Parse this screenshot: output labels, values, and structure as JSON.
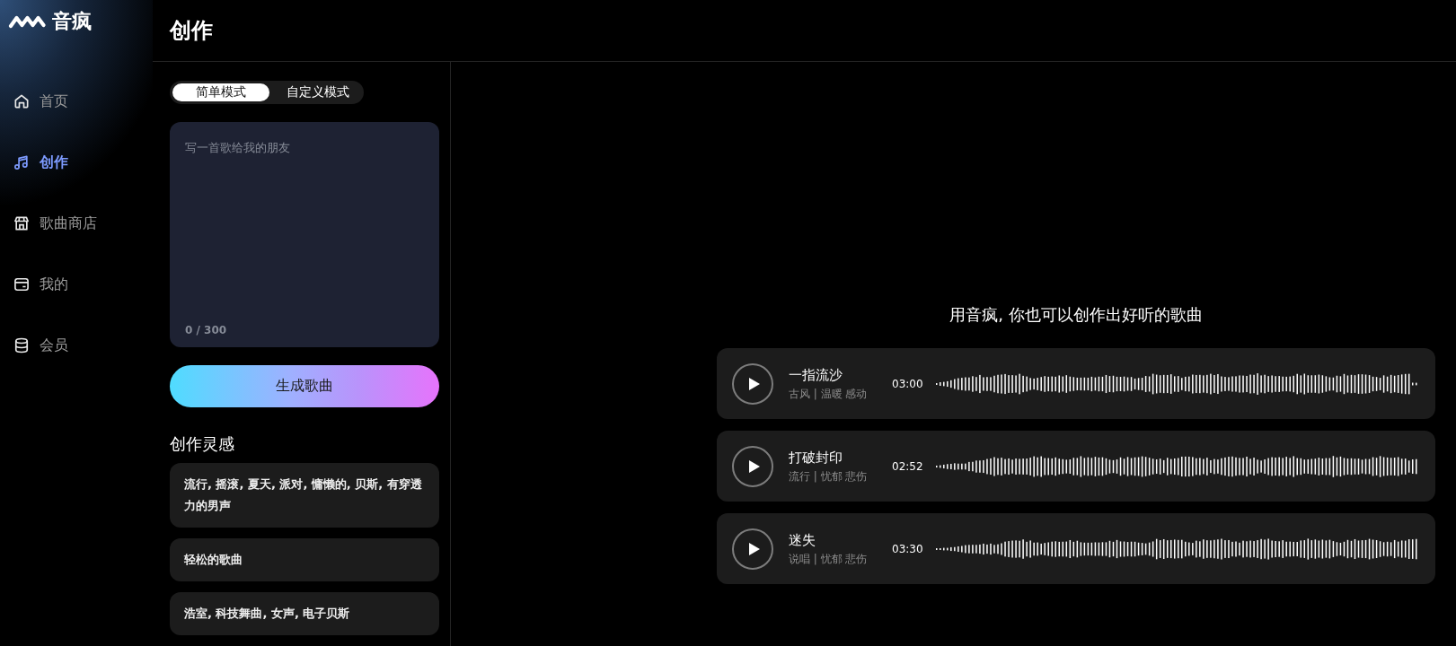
{
  "logo": {
    "name": "音疯"
  },
  "sidebar": {
    "items": [
      {
        "label": "首页",
        "selected": false
      },
      {
        "label": "创作",
        "selected": true
      },
      {
        "label": "歌曲商店",
        "selected": false
      },
      {
        "label": "我的",
        "selected": false
      },
      {
        "label": "会员",
        "selected": false
      }
    ]
  },
  "header": {
    "title": "创作"
  },
  "create_panel": {
    "modes": [
      {
        "label": "简单模式",
        "selected": true
      },
      {
        "label": "自定义模式",
        "selected": false
      }
    ],
    "prompt": {
      "placeholder": "写一首歌给我的朋友",
      "counter": "0 / 300"
    },
    "generate_button": "生成歌曲",
    "inspiration": {
      "title": "创作灵感",
      "items": [
        "流行, 摇滚, 夏天, 派对, 慵懒的, 贝斯, 有穿透力的男声",
        "轻松的歌曲",
        "浩室, 科技舞曲, 女声, 电子贝斯"
      ]
    }
  },
  "showcase": {
    "tagline": "用音疯, 你也可以创作出好听的歌曲",
    "songs": [
      {
        "title": "一指流沙",
        "tags": "古风 | 温暖 感动",
        "duration": "03:00"
      },
      {
        "title": "打破封印",
        "tags": "流行 | 忧郁 悲伤",
        "duration": "02:52"
      },
      {
        "title": "迷失",
        "tags": "说唱 | 忧郁 悲伤",
        "duration": "03:30"
      }
    ]
  }
}
